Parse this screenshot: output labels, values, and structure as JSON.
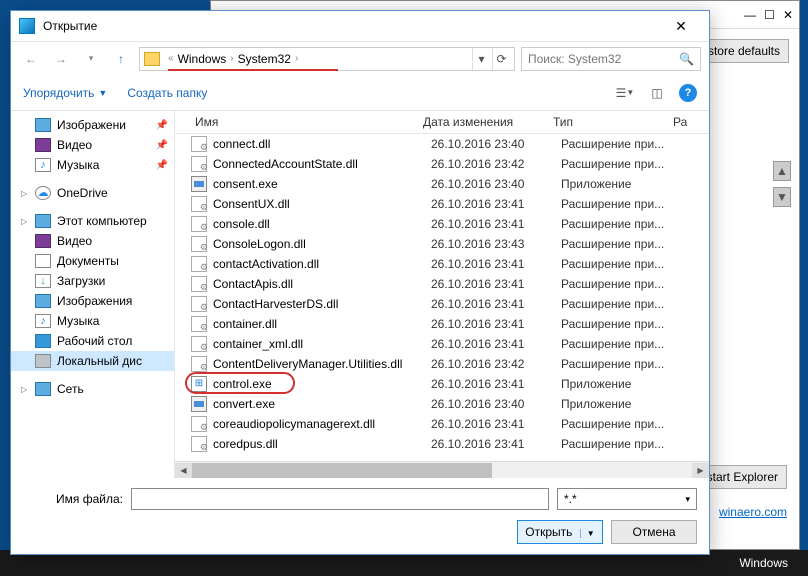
{
  "bg": {
    "restore_defaults": "Restore defaults",
    "start_explorer": "start Explorer",
    "link": "winaero.com",
    "taskbar": "Windows"
  },
  "dialog": {
    "title": "Открытие",
    "breadcrumb": {
      "sep_glyph": "«",
      "p1": "Windows",
      "p2": "System32"
    },
    "search_placeholder": "Поиск: System32",
    "toolbar": {
      "organize": "Упорядочить",
      "new_folder": "Создать папку"
    },
    "columns": {
      "name": "Имя",
      "date": "Дата изменения",
      "type": "Тип",
      "size": "Ра"
    },
    "sidebar": [
      {
        "label": "Изображени",
        "icon": "si-img",
        "pin": true
      },
      {
        "label": "Видео",
        "icon": "si-vid",
        "pin": true
      },
      {
        "label": "Музыка",
        "icon": "si-mus",
        "pin": true
      },
      {
        "spacer": true
      },
      {
        "label": "OneDrive",
        "icon": "si-od",
        "exp": true
      },
      {
        "spacer": true
      },
      {
        "label": "Этот компьютер",
        "icon": "si-pc",
        "exp": true
      },
      {
        "label": "Видео",
        "icon": "si-vid"
      },
      {
        "label": "Документы",
        "icon": "si-doc"
      },
      {
        "label": "Загрузки",
        "icon": "si-dl"
      },
      {
        "label": "Изображения",
        "icon": "si-img"
      },
      {
        "label": "Музыка",
        "icon": "si-mus"
      },
      {
        "label": "Рабочий стол",
        "icon": "si-desk"
      },
      {
        "label": "Локальный дис",
        "icon": "si-disk",
        "sel": true
      },
      {
        "spacer": true
      },
      {
        "label": "Сеть",
        "icon": "si-net",
        "exp": true
      }
    ],
    "files": [
      {
        "name": "connect.dll",
        "date": "26.10.2016 23:40",
        "type": "Расширение при...",
        "icon": "dll"
      },
      {
        "name": "ConnectedAccountState.dll",
        "date": "26.10.2016 23:42",
        "type": "Расширение при...",
        "icon": "dll"
      },
      {
        "name": "consent.exe",
        "date": "26.10.2016 23:40",
        "type": "Приложение",
        "icon": "exe"
      },
      {
        "name": "ConsentUX.dll",
        "date": "26.10.2016 23:41",
        "type": "Расширение при...",
        "icon": "dll"
      },
      {
        "name": "console.dll",
        "date": "26.10.2016 23:41",
        "type": "Расширение при...",
        "icon": "dll"
      },
      {
        "name": "ConsoleLogon.dll",
        "date": "26.10.2016 23:43",
        "type": "Расширение при...",
        "icon": "dll"
      },
      {
        "name": "contactActivation.dll",
        "date": "26.10.2016 23:41",
        "type": "Расширение при...",
        "icon": "dll"
      },
      {
        "name": "ContactApis.dll",
        "date": "26.10.2016 23:41",
        "type": "Расширение при...",
        "icon": "dll"
      },
      {
        "name": "ContactHarvesterDS.dll",
        "date": "26.10.2016 23:41",
        "type": "Расширение при...",
        "icon": "dll"
      },
      {
        "name": "container.dll",
        "date": "26.10.2016 23:41",
        "type": "Расширение при...",
        "icon": "dll"
      },
      {
        "name": "container_xml.dll",
        "date": "26.10.2016 23:41",
        "type": "Расширение при...",
        "icon": "dll"
      },
      {
        "name": "ContentDeliveryManager.Utilities.dll",
        "date": "26.10.2016 23:42",
        "type": "Расширение при...",
        "icon": "dll"
      },
      {
        "name": "control.exe",
        "date": "26.10.2016 23:41",
        "type": "Приложение",
        "icon": "ctrl",
        "highlight": true
      },
      {
        "name": "convert.exe",
        "date": "26.10.2016 23:40",
        "type": "Приложение",
        "icon": "exe"
      },
      {
        "name": "coreaudiopolicymanagerext.dll",
        "date": "26.10.2016 23:41",
        "type": "Расширение при...",
        "icon": "dll"
      },
      {
        "name": "coredpus.dll",
        "date": "26.10.2016 23:41",
        "type": "Расширение при...",
        "icon": "dll"
      }
    ],
    "filename_label": "Имя файла:",
    "filter": "*.*",
    "open": "Открыть",
    "cancel": "Отмена"
  }
}
